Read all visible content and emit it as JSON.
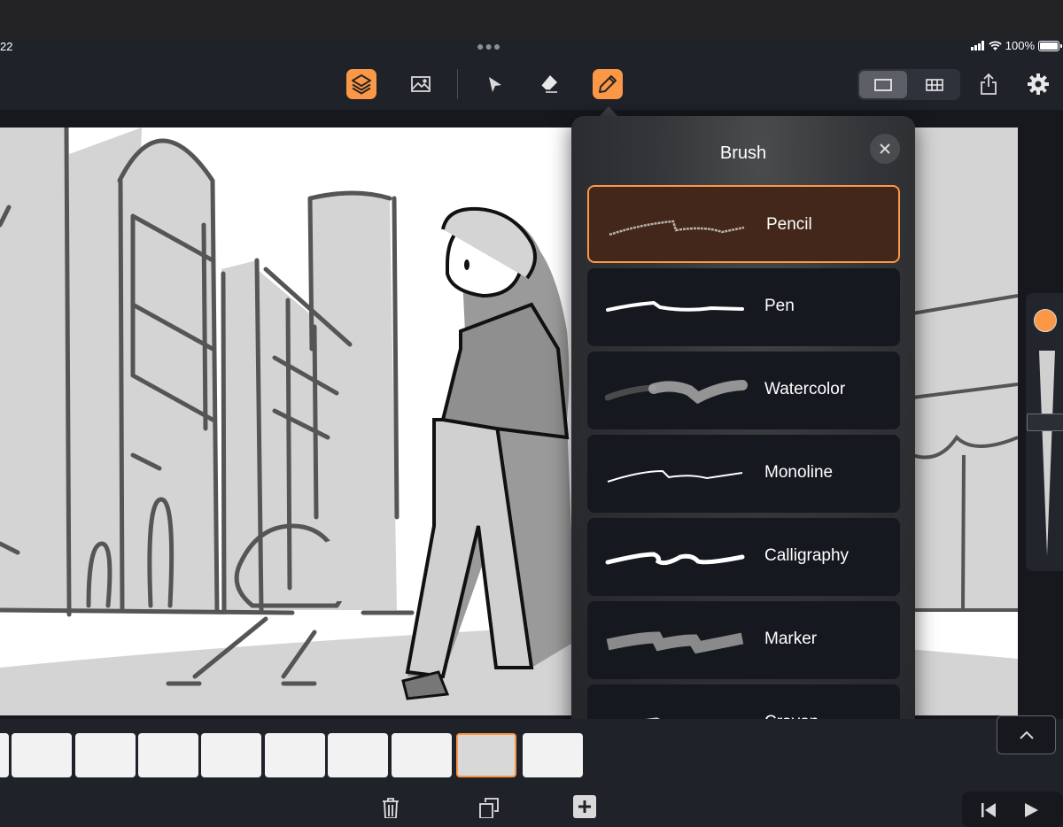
{
  "status_bar": {
    "time": "22",
    "battery": "100%",
    "more_icon": "ellipsis-icon"
  },
  "toolbar": {
    "tools": [
      {
        "name": "layers",
        "icon": "layers-icon",
        "active": true
      },
      {
        "name": "image",
        "icon": "image-icon",
        "active": false
      },
      {
        "name": "select",
        "icon": "pointer-arrow-icon",
        "active": false
      },
      {
        "name": "eraser",
        "icon": "eraser-icon",
        "active": false
      },
      {
        "name": "pencil",
        "icon": "pencil-icon",
        "active": true
      }
    ],
    "view_modes": [
      {
        "name": "single-panel",
        "icon": "single-frame-icon",
        "selected": true
      },
      {
        "name": "grid",
        "icon": "grid-icon",
        "selected": false
      }
    ],
    "share_icon": "share-icon",
    "settings_icon": "gear-icon"
  },
  "brush_panel": {
    "title": "Brush",
    "close_icon": "close-icon",
    "selected": "Pencil",
    "brushes": [
      {
        "label": "Pencil",
        "selected": true
      },
      {
        "label": "Pen",
        "selected": false
      },
      {
        "label": "Watercolor",
        "selected": false
      },
      {
        "label": "Monoline",
        "selected": false
      },
      {
        "label": "Calligraphy",
        "selected": false
      },
      {
        "label": "Marker",
        "selected": false
      },
      {
        "label": "Crayon",
        "selected": false
      }
    ]
  },
  "side_panel": {
    "color": "#fb9847",
    "brush_size_fraction": 0.35
  },
  "filmstrip": {
    "frames": [
      {
        "name": "frame-a"
      },
      {
        "name": "frame-b"
      },
      {
        "name": "frame-c"
      },
      {
        "name": "frame-d"
      },
      {
        "name": "frame-e"
      },
      {
        "name": "frame-f"
      },
      {
        "name": "frame-g"
      },
      {
        "name": "frame-h"
      },
      {
        "name": "frame-i"
      },
      {
        "name": "frame-j"
      }
    ],
    "selected_index": 8
  },
  "bottom_bar": {
    "delete_icon": "trash-icon",
    "duplicate_icon": "duplicate-icon",
    "add_icon": "plus-icon",
    "expand_icon": "chevron-up-icon",
    "prev_icon": "skip-back-icon",
    "play_icon": "play-icon"
  },
  "colors": {
    "accent": "#fb9847",
    "panel_bg": "#1f2229",
    "canvas_bg": "#16181d"
  }
}
